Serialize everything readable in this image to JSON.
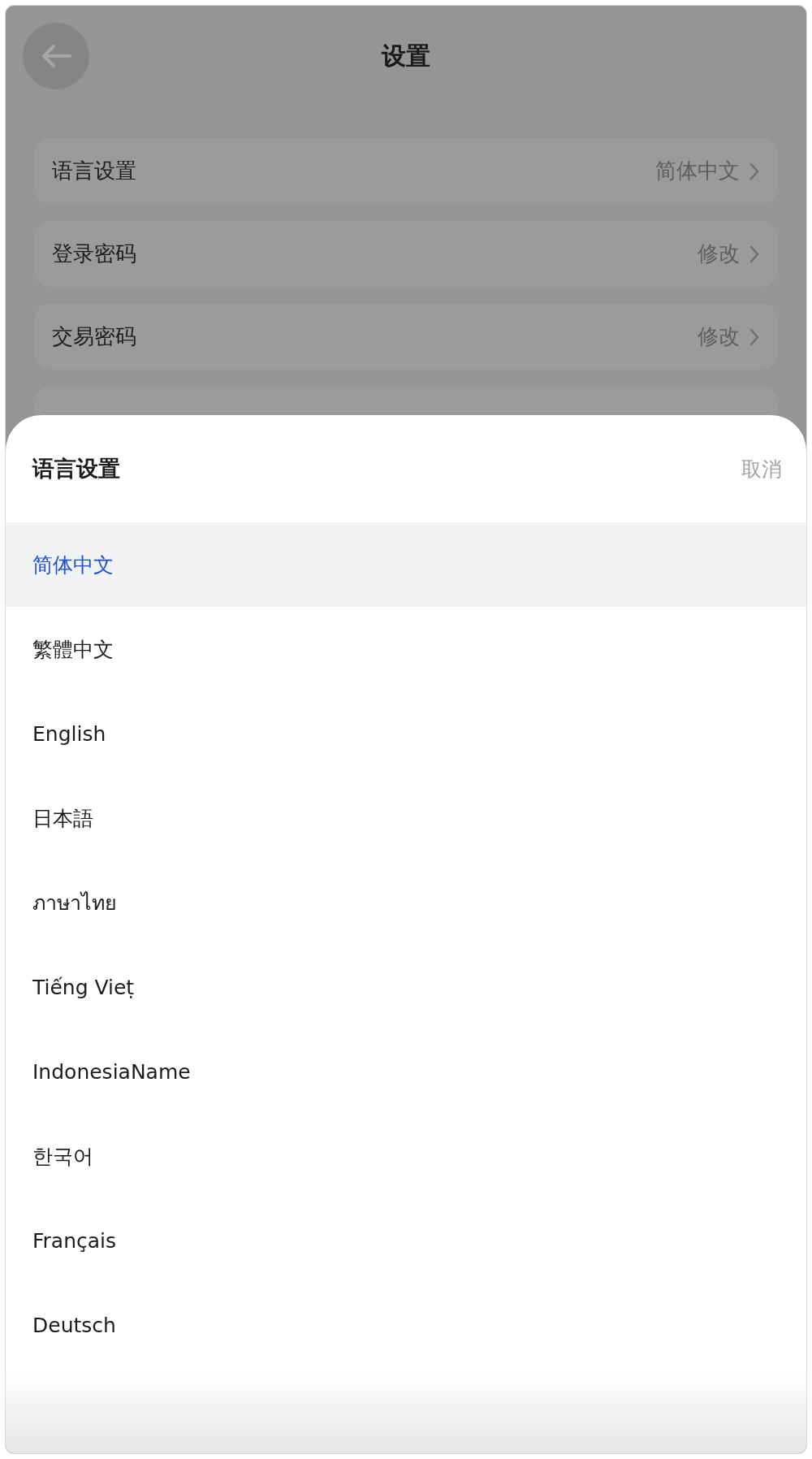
{
  "header": {
    "title": "设置"
  },
  "settings": [
    {
      "kind": "link",
      "label": "语言设置",
      "value": "简体中文"
    },
    {
      "kind": "link",
      "label": "登录密码",
      "value": "修改"
    },
    {
      "kind": "link",
      "label": "交易密码",
      "value": "修改"
    },
    {
      "kind": "covered"
    }
  ],
  "sheet": {
    "title": "语言设置",
    "cancel": "取消",
    "options": [
      {
        "label": "简体中文",
        "selected": true
      },
      {
        "label": "繁體中文",
        "selected": false
      },
      {
        "label": "English",
        "selected": false
      },
      {
        "label": "日本語",
        "selected": false
      },
      {
        "label": "ภาษาไทย",
        "selected": false
      },
      {
        "label": "Tiếng Vieṭ",
        "selected": false
      },
      {
        "label": "IndonesiaName",
        "selected": false
      },
      {
        "label": "한국어",
        "selected": false
      },
      {
        "label": "Français",
        "selected": false
      },
      {
        "label": "Deutsch",
        "selected": false
      }
    ]
  }
}
